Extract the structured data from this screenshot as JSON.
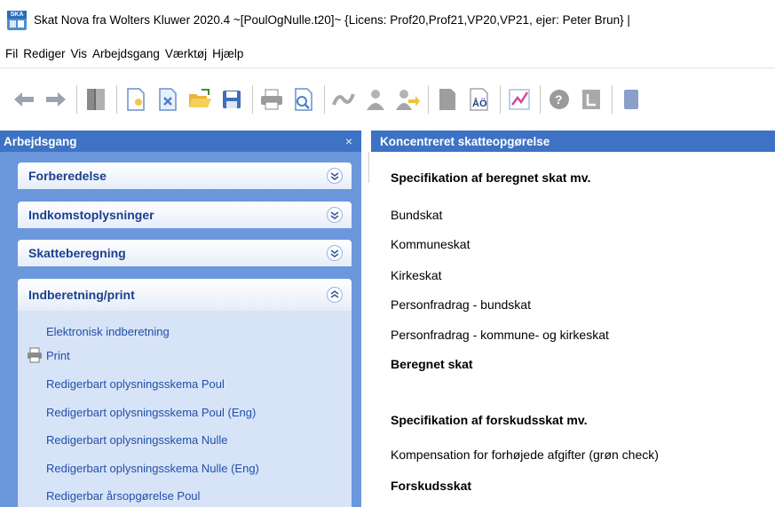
{
  "window": {
    "title": "Skat Nova fra Wolters Kluwer 2020.4  ~[PoulOgNulle.t20]~   {Licens: Prof20,Prof21,VP20,VP21, ejer: Peter Brun}  |",
    "icon_text": "SKA"
  },
  "menu": [
    "Fil",
    "Rediger",
    "Vis",
    "Arbejdsgang",
    "Værktøj",
    "Hjælp"
  ],
  "toolbar": {
    "icons": [
      "back-arrow-icon",
      "forward-arrow-icon",
      "book-icon",
      "new-document-icon",
      "close-document-icon",
      "open-folder-icon",
      "save-icon",
      "print-icon",
      "preview-icon",
      "link-icon",
      "person-icon",
      "person-transfer-icon",
      "document-icon",
      "spellcheck-icon",
      "chart-check-icon",
      "help-icon",
      "exit-icon",
      "calculator-icon"
    ]
  },
  "left_pane": {
    "title": "Arbejdsgang",
    "close_symbol": "×",
    "groups": [
      {
        "label": "Forberedelse",
        "expanded": false
      },
      {
        "label": "Indkomstoplysninger",
        "expanded": false
      },
      {
        "label": "Skatteberegning",
        "expanded": false
      },
      {
        "label": "Indberetning/print",
        "expanded": true
      }
    ],
    "tasks": [
      "Elektronisk indberetning",
      "Print",
      "Redigerbart oplysningsskema Poul",
      "Redigerbart oplysningsskema Poul (Eng)",
      "Redigerbart oplysningsskema Nulle",
      "Redigerbart oplysningsskema Nulle (Eng)",
      "Redigerbar årsopgørelse Poul"
    ]
  },
  "right_pane": {
    "title": "Koncentreret skatteopgørelse",
    "section1_heading": "Specifikation af beregnet skat mv.",
    "section1_items": [
      "Bundskat",
      "Kommuneskat",
      "Kirkeskat",
      "Personfradrag - bundskat",
      "Personfradrag - kommune- og kirkeskat"
    ],
    "section1_total": "Beregnet skat",
    "section2_heading": "Specifikation af forskudsskat mv.",
    "section2_items": [
      "Kompensation for forhøjede afgifter (grøn check)"
    ],
    "section2_total": "Forskudsskat"
  },
  "colors": {
    "pane_header": "#3d72c4",
    "left_pane_bg": "#6b97dc",
    "group_label": "#1b3f8f",
    "task_link": "#2150a8",
    "group_body": "#d7e3f7"
  }
}
